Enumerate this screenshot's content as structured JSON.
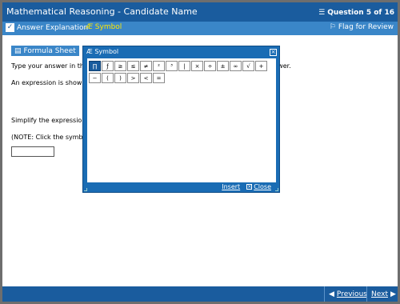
{
  "titlebar": {
    "title": "Mathematical Reasoning - Candidate Name",
    "question_counter": "Question 5 of 16"
  },
  "toolbar": {
    "answer_explanation": "Answer Explanation",
    "symbol": "Symbol",
    "flag": "Flag for Review"
  },
  "content": {
    "formula_sheet": "Formula Sheet",
    "line1_left": "Type your answer in th",
    "line1_right": "swer.",
    "line2": "An expression is show",
    "line3": "Simplify the expressio",
    "line4": "(NOTE: Click the symb",
    "answer_value": ""
  },
  "dialog": {
    "title": "Symbol",
    "symbols_row1": [
      "∏",
      "ƒ",
      "≥",
      "≤",
      "≠",
      "²",
      "³",
      "|",
      "×",
      "÷",
      "±",
      "∞",
      "√",
      "+"
    ],
    "symbols_row2": [
      "−",
      "(",
      ")",
      ">",
      "<",
      "="
    ],
    "selected_symbol": "∏",
    "insert": "Insert",
    "close": "Close"
  },
  "bottombar": {
    "previous": "Previous",
    "next": "Next"
  },
  "colors": {
    "titlebar": "#1a5c9e",
    "toolbar": "#3a86c8",
    "symbol_label": "#ffe600",
    "dialog": "#1a6cb4"
  }
}
